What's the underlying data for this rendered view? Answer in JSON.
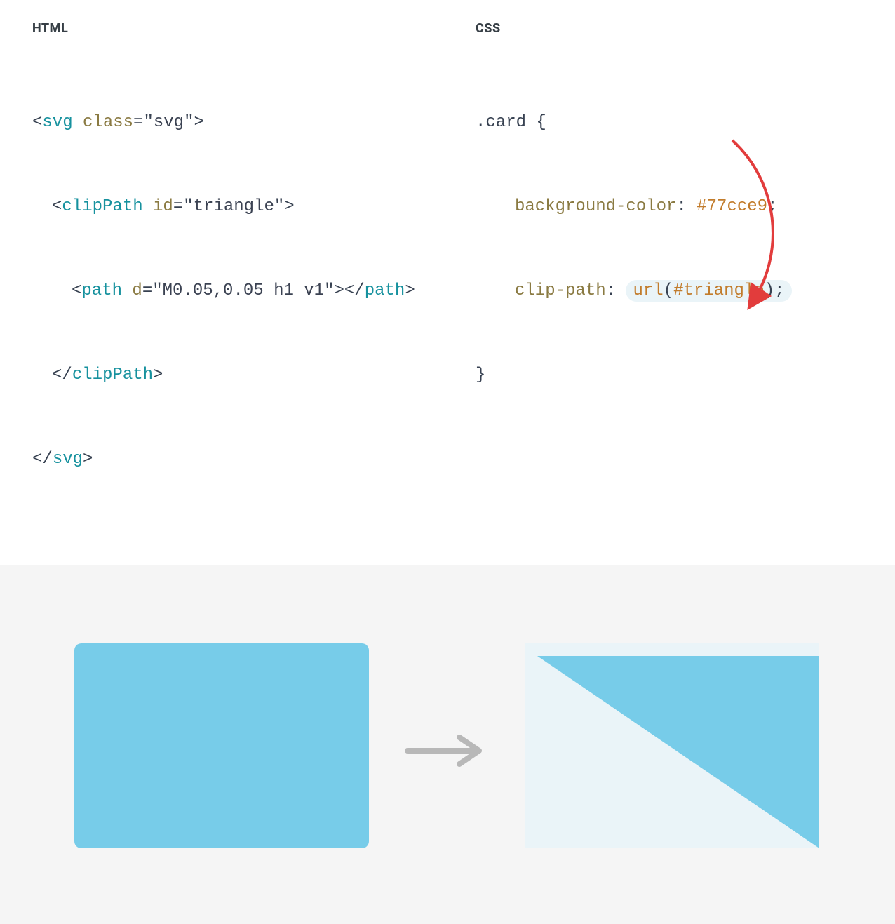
{
  "headings": {
    "html": "HTML",
    "css": "CSS"
  },
  "html_code": {
    "line1": {
      "lt": "<",
      "tag": "svg",
      "sp": " ",
      "attr": "class",
      "eq": "=",
      "q1": "\"",
      "val": "svg",
      "q2": "\"",
      "gt": ">"
    },
    "line2": {
      "lt": "<",
      "tag": "clipPath",
      "sp": " ",
      "attr": "id",
      "eq": "=",
      "q1": "\"",
      "val": "triangle",
      "q2": "\"",
      "gt": ">"
    },
    "line3": {
      "lt": "<",
      "tag": "path",
      "sp": " ",
      "attr": "d",
      "eq": "=",
      "q1": "\"",
      "val": "M0.05,0.05 h1 v1",
      "q2": "\"",
      "gt": ">",
      "lt2": "</",
      "tag2": "path",
      "gt2": ">"
    },
    "line4": {
      "lt": "</",
      "tag": "clipPath",
      "gt": ">"
    },
    "line5": {
      "lt": "</",
      "tag": "svg",
      "gt": ">"
    }
  },
  "css_code": {
    "line1": {
      "selector": ".card",
      "brace": " {"
    },
    "line2": {
      "prop": "background-color",
      "colon": ": ",
      "value": "#77cce9",
      "semi": ";"
    },
    "line3": {
      "prop": "clip-path",
      "colon": ": ",
      "urlfn": "url",
      "paren_open": "(",
      "urlval": "#triangle",
      "paren_close": ")",
      "semi": ";"
    },
    "line4": {
      "brace": "}"
    }
  },
  "colors": {
    "card_bg": "#77cce9",
    "arrow_red": "#e23c3c"
  }
}
